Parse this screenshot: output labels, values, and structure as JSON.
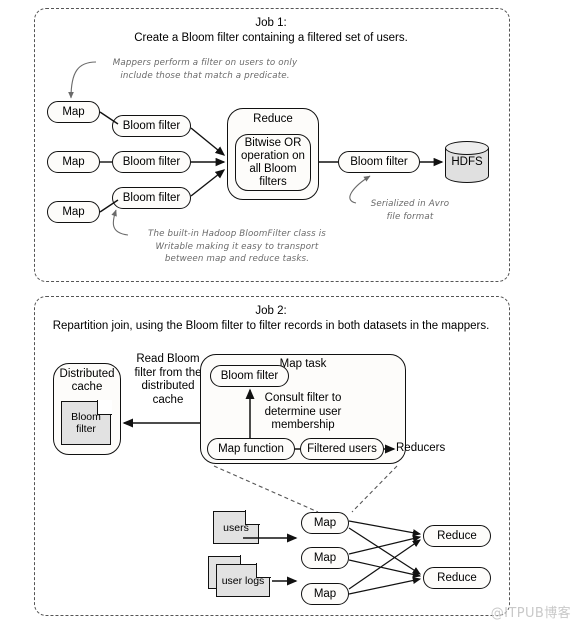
{
  "job1": {
    "title_line1": "Job 1:",
    "title_line2": "Create a Bloom filter containing a filtered set of users.",
    "note_mappers": "Mappers perform a filter on users to only\ninclude those that match a predicate.",
    "note_writable": "The built-in Hadoop BloomFilter class is\nWritable making it easy to transport\nbetween map and reduce tasks.",
    "note_avro": "Serialized in Avro\nfile format",
    "map1": "Map",
    "map2": "Map",
    "map3": "Map",
    "bloom1": "Bloom filter",
    "bloom2": "Bloom filter",
    "bloom3": "Bloom filter",
    "reduce_title": "Reduce",
    "reduce_inner": "Bitwise OR\noperation on\nall Bloom filters",
    "bloom_out": "Bloom filter",
    "hdfs": "HDFS"
  },
  "job2": {
    "title_line1": "Job 2:",
    "title_line2": "Repartition join, using the Bloom filter to filter records in both datasets in the mappers.",
    "dist_cache_title": "Distributed\ncache",
    "dist_cache_doc": "Bloom\nfilter",
    "read_label": "Read Bloom\nfilter from the\ndistributed\ncache",
    "map_task_title": "Map task",
    "bloom_filter_node": "Bloom filter",
    "consult_label": "Consult filter to\ndetermine user\nmembership",
    "map_function": "Map function",
    "filtered_users": "Filtered users",
    "reducers_label": "Reducers",
    "doc_users": "users",
    "doc_user_logs": "user logs",
    "map_a": "Map",
    "map_b": "Map",
    "map_c": "Map",
    "reduce_a": "Reduce",
    "reduce_b": "Reduce"
  },
  "watermark": "@ITPUB博客",
  "colors": {
    "stroke": "#111111",
    "panel_border": "#555555",
    "note_text": "#6a6a6a",
    "doc_fill": "#e2e2e2",
    "cylinder_fill": "#e0e0e0",
    "node_fill": "#fdfcfa",
    "watermark": "#c9c9c9"
  }
}
